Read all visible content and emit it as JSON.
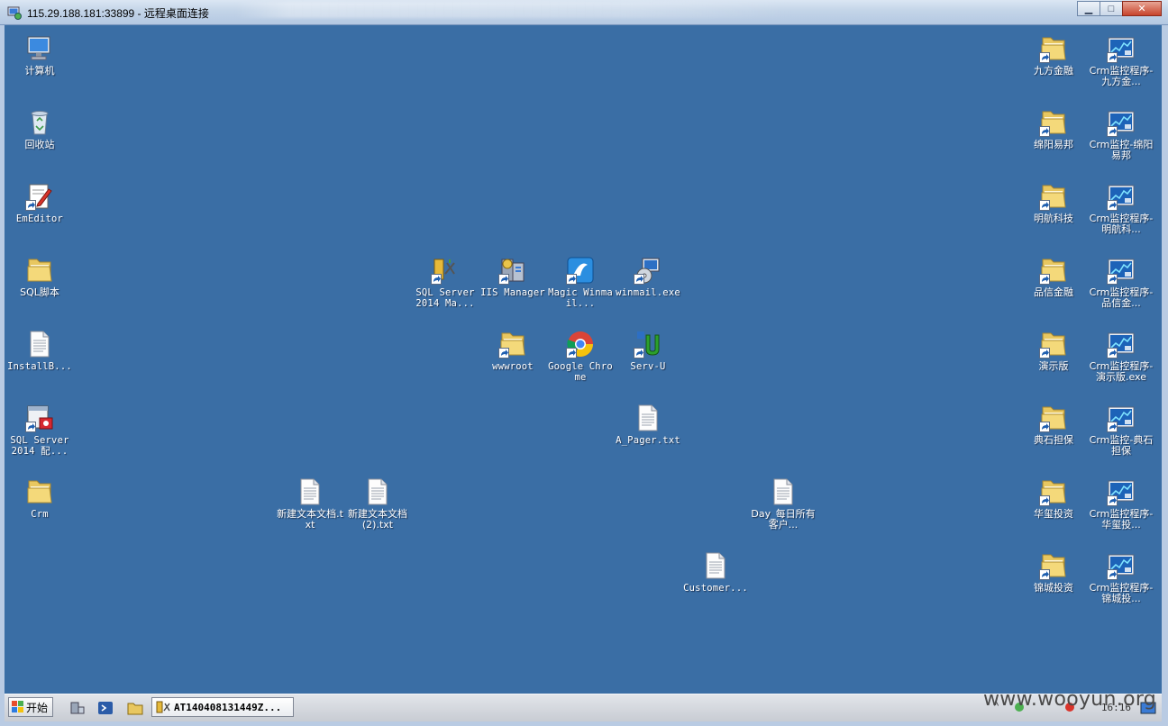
{
  "window": {
    "title": "115.29.188.181:33899 - 远程桌面连接",
    "controls": {
      "minimize": "▁",
      "maximize": "□",
      "close": "✕"
    }
  },
  "desktop": {
    "background_color": "#3a6ea5",
    "icons": {
      "computer": {
        "label": "计算机",
        "icon": "computer-icon"
      },
      "recycle_bin": {
        "label": "回收站",
        "icon": "recycle-bin-icon"
      },
      "emeditor": {
        "label": "EmEditor",
        "icon": "emeditor-icon"
      },
      "sql_scripts": {
        "label": "SQL脚本",
        "icon": "folder-icon"
      },
      "installb": {
        "label": "InstallB...",
        "icon": "text-file-icon"
      },
      "sql_config": {
        "label": "SQL Server 2014 配...",
        "icon": "sql-config-icon"
      },
      "crm": {
        "label": "Crm",
        "icon": "folder-icon"
      },
      "sql_mgmt": {
        "label": "SQL Server 2014 Ma...",
        "icon": "sql-management-icon"
      },
      "iis": {
        "label": "IIS Manager",
        "icon": "iis-icon"
      },
      "magic_winmail": {
        "label": "Magic Winmail...",
        "icon": "winmail-icon"
      },
      "winmail_exe": {
        "label": "winmail.exe",
        "icon": "installer-icon"
      },
      "wwwroot": {
        "label": "wwwroot",
        "icon": "folder-icon"
      },
      "chrome": {
        "label": "Google Chrome",
        "icon": "chrome-icon"
      },
      "servu": {
        "label": "Serv-U",
        "icon": "servu-icon"
      },
      "a_pager": {
        "label": "A_Pager.txt",
        "icon": "text-file-icon"
      },
      "new_text": {
        "label": "新建文本文档.txt",
        "icon": "text-file-icon"
      },
      "new_text2": {
        "label": "新建文本文档 (2).txt",
        "icon": "text-file-icon"
      },
      "day_customers": {
        "label": "Day_每日所有客户...",
        "icon": "text-file-icon"
      },
      "customer": {
        "label": "Customer...",
        "icon": "text-file-icon"
      },
      "jiufang": {
        "label": "九方金融",
        "icon": "folder-icon"
      },
      "crm_jiufang": {
        "label": "Crm监控程序-九方金...",
        "icon": "monitor-app-icon"
      },
      "mianyang": {
        "label": "绵阳易邦",
        "icon": "folder-icon"
      },
      "crm_mianyang": {
        "label": "Crm监控-绵阳易邦",
        "icon": "monitor-app-icon"
      },
      "minghang": {
        "label": "明航科技",
        "icon": "folder-icon"
      },
      "crm_minghang": {
        "label": "Crm监控程序-明航科...",
        "icon": "monitor-app-icon"
      },
      "pinxin": {
        "label": "品信金融",
        "icon": "folder-icon"
      },
      "crm_pinxin": {
        "label": "Crm监控程序-品信金...",
        "icon": "monitor-app-icon"
      },
      "demo": {
        "label": "演示版",
        "icon": "folder-icon"
      },
      "crm_demo": {
        "label": "Crm监控程序-演示版.exe",
        "icon": "monitor-app-icon"
      },
      "dianshi": {
        "label": "典石担保",
        "icon": "folder-icon"
      },
      "crm_dianshi": {
        "label": "Crm监控-典石担保",
        "icon": "monitor-app-icon"
      },
      "huaxi": {
        "label": "华玺投资",
        "icon": "folder-icon"
      },
      "crm_huaxi": {
        "label": "Crm监控程序-华玺投...",
        "icon": "monitor-app-icon"
      },
      "jincheng": {
        "label": "锦城投资",
        "icon": "folder-icon"
      },
      "crm_jincheng": {
        "label": "Crm监控程序-锦城投...",
        "icon": "monitor-app-icon"
      }
    }
  },
  "taskbar": {
    "start_label": "开始",
    "task_label": "AT140408131449Z...",
    "clock": "16:16"
  },
  "watermark": "www.wooyun.org"
}
